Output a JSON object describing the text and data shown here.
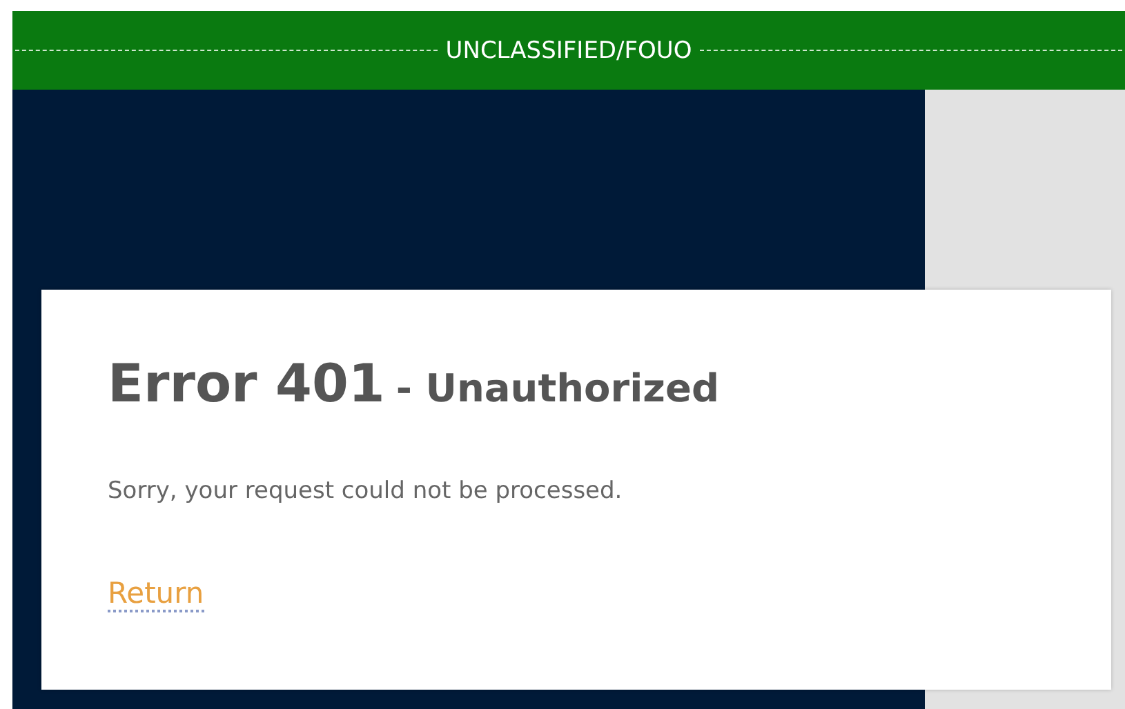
{
  "banner": {
    "label": "UNCLASSIFIED/FOUO"
  },
  "error": {
    "code": "Error 401",
    "name": "- Unauthorized",
    "message": "Sorry, your request could not be processed.",
    "link": "Return"
  }
}
